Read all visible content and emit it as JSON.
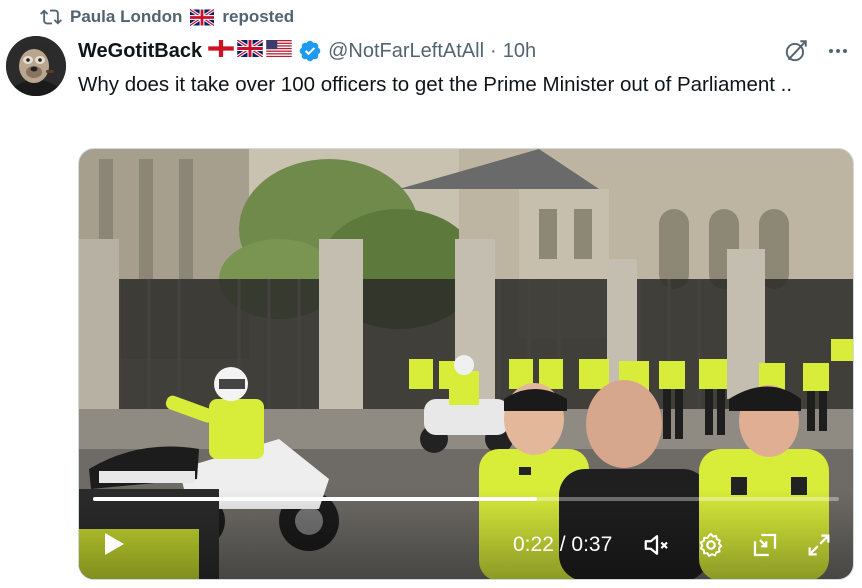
{
  "repost": {
    "name": "Paula London",
    "label": "reposted",
    "icon": "repost-icon",
    "flag": "uk-flag-icon"
  },
  "author": {
    "display_name": "WeGotitBack",
    "handle": "@NotFarLeftAtAll",
    "separator": "·",
    "time": "10h",
    "flags": [
      "england-flag-icon",
      "uk-flag-icon",
      "us-flag-icon"
    ],
    "verified_icon": "verified-badge-icon",
    "avatar": "avatar"
  },
  "actions": {
    "grok_icon": "grok-icon",
    "more_icon": "more-icon"
  },
  "tweet": {
    "text": "Why does it take over 100 officers to get the Prime Minister out of Parliament .."
  },
  "video": {
    "current_time": "0:22",
    "separator": " / ",
    "duration": "0:37",
    "progress": 0.595,
    "play_icon": "play-icon",
    "mute_icon": "mute-icon",
    "settings_icon": "settings-gear-icon",
    "pip_icon": "picture-in-picture-icon",
    "fullscreen_icon": "fullscreen-icon"
  },
  "colors": {
    "verified": "#1d9bf0",
    "secondary_text": "#536471",
    "primary_text": "#0f1419",
    "hi_vis": "#d8ec3a"
  }
}
